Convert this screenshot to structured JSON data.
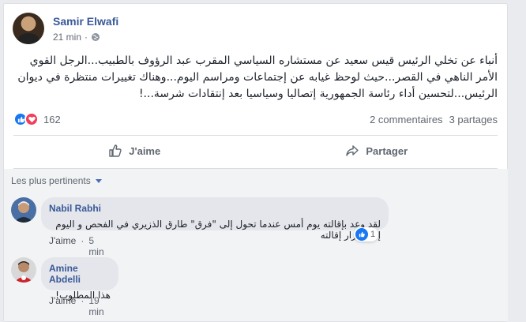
{
  "post": {
    "author": "Samir Elwafi",
    "time": "21 min",
    "text": "أنباء عن تخلي الرئيس قيس سعيد عن مستشاره السياسي المقرب عبد الرؤوف بالطبيب...الرجل القوي الأمر الناهي في القصر...حيث لوحظ غيابه عن إجتماعات ومراسم اليوم...وهناك تغييرات منتظرة في ديوان الرئيس...لتحسين أداء رئاسة الجمهورية إتصاليا وسياسيا بعد إنتقادات شرسة...!",
    "reactions_count": "162",
    "comments_count": "2 commentaires",
    "shares_count": "3 partages"
  },
  "actions": {
    "like_label": "J'aime",
    "share_label": "Partager"
  },
  "comments_section": {
    "sort_label": "Les plus pertinents",
    "comments": [
      {
        "name": "Nabil Rabhi",
        "text": "لقد وعد بإقالته يوم أمس عندما تحول إلى \"فرق\" طارق الذزيري في الفحص و اليوم إتخذ قرار إقالته",
        "like_label": "J'aime",
        "separator": "·",
        "time": "5 min",
        "reaction_count": "1"
      },
      {
        "name": "Amine Abdelli",
        "text": "هذا المطلوب!",
        "like_label": "J'aime",
        "separator": "·",
        "time": "19 min"
      }
    ]
  },
  "colors": {
    "link_blue": "#385898",
    "like_blue": "#1877f2",
    "love_red": "#f33e58"
  }
}
